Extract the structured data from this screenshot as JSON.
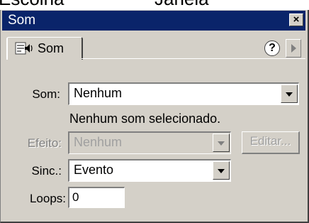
{
  "header_caption": {
    "left": "Escolha",
    "right": "Janela"
  },
  "window": {
    "title": "Som",
    "close_glyph": "×"
  },
  "tab": {
    "label": "Som",
    "help_glyph": "?",
    "icon": "sound-properties-icon"
  },
  "form": {
    "sound_label": "Som:",
    "sound_value": "Nenhum",
    "status_text": "Nenhum som selecionado.",
    "effect_label": "Efeito:",
    "effect_value": "Nenhum",
    "edit_button": "Editar...",
    "sync_label": "Sinc.:",
    "sync_value": "Evento",
    "loops_label": "Loops:",
    "loops_value": "0"
  },
  "colors": {
    "titlebar": "#0a246a",
    "panel": "#d4d0c8",
    "disabled_text": "#808080"
  }
}
